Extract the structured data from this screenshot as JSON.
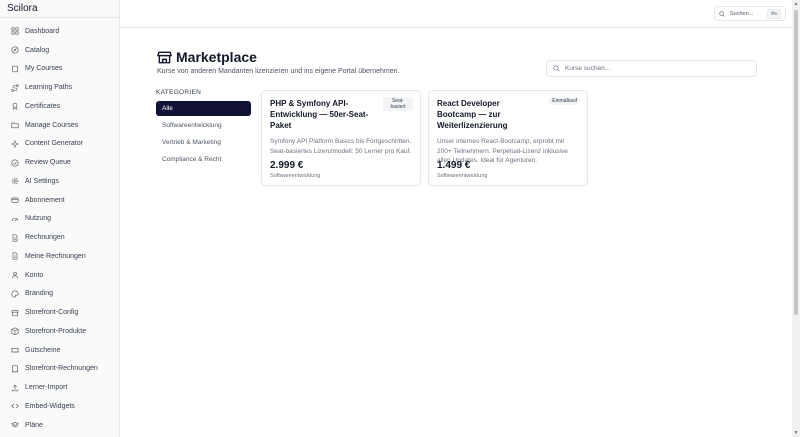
{
  "app": {
    "brand": "Scilora"
  },
  "sidebar": {
    "items": [
      {
        "label": "Dashboard",
        "icon": "grid-icon"
      },
      {
        "label": "Catalog",
        "icon": "compass-icon"
      },
      {
        "label": "My Courses",
        "icon": "book-icon"
      },
      {
        "label": "Learning Paths",
        "icon": "path-icon"
      },
      {
        "label": "Certificates",
        "icon": "certificate-icon"
      },
      {
        "label": "Manage Courses",
        "icon": "folder-icon"
      },
      {
        "label": "Content Generator",
        "icon": "sparkle-icon"
      },
      {
        "label": "Review Queue",
        "icon": "check-circle-icon"
      },
      {
        "label": "AI Settings",
        "icon": "gear-icon"
      },
      {
        "label": "Abonnement",
        "icon": "card-icon"
      },
      {
        "label": "Nutzung",
        "icon": "gauge-icon"
      },
      {
        "label": "Rechnungen",
        "icon": "document-icon"
      },
      {
        "label": "Meine Rechnungen",
        "icon": "document-icon"
      },
      {
        "label": "Konto",
        "icon": "user-icon"
      },
      {
        "label": "Branding",
        "icon": "palette-icon"
      },
      {
        "label": "Storefront-Config",
        "icon": "store-icon"
      },
      {
        "label": "Storefront-Produkte",
        "icon": "box-icon"
      },
      {
        "label": "Gutscheine",
        "icon": "ticket-icon"
      },
      {
        "label": "Storefront-Rechnungen",
        "icon": "receipt-icon"
      },
      {
        "label": "Lerner-Import",
        "icon": "upload-icon"
      },
      {
        "label": "Embed-Widgets",
        "icon": "code-icon"
      },
      {
        "label": "Pläne",
        "icon": "layers-icon"
      }
    ]
  },
  "topbar": {
    "search_label": "Suchen...",
    "shortcut": "⌘K"
  },
  "page": {
    "title": "Marketplace",
    "subtitle": "Kurse von anderen Mandanten lizenzieren und ins eigene Portal übernehmen.",
    "search_placeholder": "Kurse suchen..."
  },
  "categories": {
    "heading": "KATEGORIEN",
    "items": [
      "Alle",
      "Softwareentwicklung",
      "Vertrieb & Marketing",
      "Compliance & Recht"
    ],
    "selected": "Alle"
  },
  "courses": [
    {
      "title": "PHP & Symfony API-Entwicklung — 50er-Seat-Paket",
      "badge": "Seat-basiert",
      "description": "Symfony API Platform Basics bis Fortgeschritten. Seat-basiertes Lizenzmodell: 50 Lerner pro Kauf.",
      "price": "2.999 €",
      "category": "Softwareentwicklung"
    },
    {
      "title": "React Developer Bootcamp — zur Weiterlizenzierung",
      "badge": "Einmalkauf",
      "description": "Unser internes React-Bootcamp, erprobt mit 200+ Teilnehmern. Perpetual-Lizenz inklusive allen Updates. Ideal für Agenturen.",
      "price": "1.499 €",
      "category": "Softwareentwicklung"
    }
  ],
  "colors": {
    "accent": "#111135",
    "border": "#e5e7eb",
    "muted_text": "#6b7280"
  }
}
